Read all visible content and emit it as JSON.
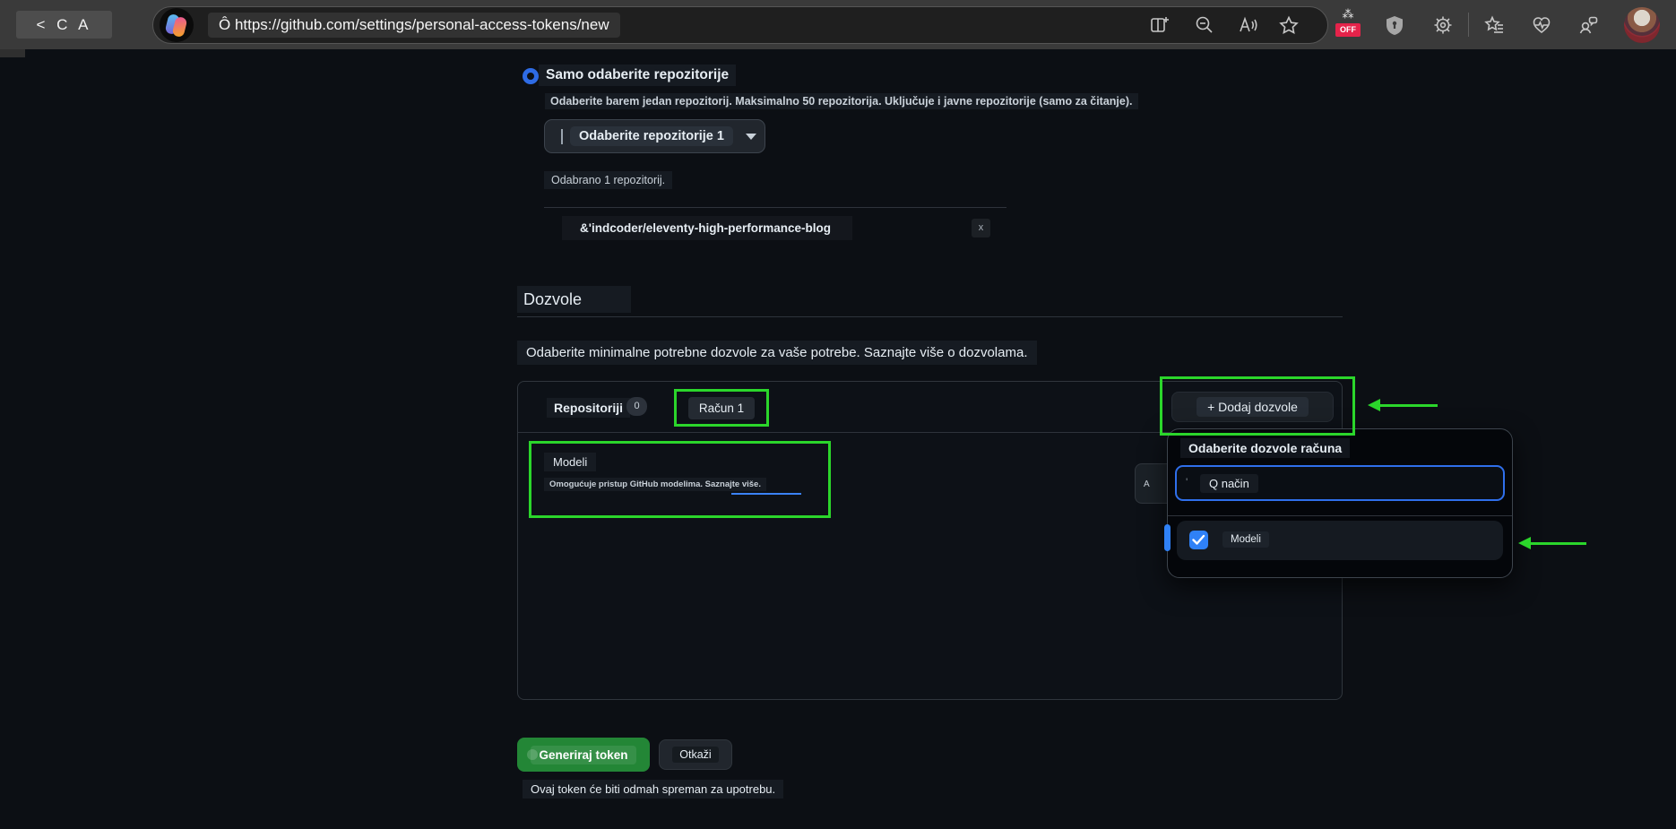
{
  "browser": {
    "nav_back_group": "< C A",
    "url": "Ô https://github.com/settings/personal-access-tokens/new",
    "off_badge": "OFF",
    "off_rays": "⁂",
    "icons": [
      "copilot-logo",
      "split-screen-icon",
      "zoom-out-icon",
      "read-aloud-icon",
      "favorite-star-icon",
      "shopping-off-icon",
      "tracking-shield-icon",
      "settings-gear-icon",
      "favorites-list-icon",
      "browser-health-icon",
      "profile-chat-icon",
      "user-avatar"
    ]
  },
  "page": {
    "repo_access": {
      "radio_label": "Samo odaberite repozitorije",
      "radio_hint": "Odaberite barem jedan repozitorij. Maksimalno 50 repozitorija. Uključuje i javne repozitorije (samo za čitanje).",
      "select_button_label": "Odaberite repozitorije 1",
      "selected_count": "Odabrano 1 repozitorij.",
      "repo_name": "&'indcoder/eleventy-high-performance-blog",
      "remove_label": "x"
    },
    "permissions": {
      "title": "Dozvole",
      "subtitle": "Odaberite minimalne potrebne dozvole za vaše potrebe. Saznajte više o dozvolama.",
      "tabs": [
        {
          "label": "Repositoriji",
          "badge": "0"
        },
        {
          "label": "Račun 1"
        }
      ],
      "add_button_label": "+ Dodaj dozvole",
      "model_section": {
        "title": "Modeli",
        "description": "Omogućuje pristup GitHub modelima. Saznajte više."
      },
      "hidden_button": "A"
    },
    "popup": {
      "title": "Odaberite dozvole računa",
      "search_value": "Q način",
      "search_tick": "'",
      "option_label": "Modeli"
    },
    "footer": {
      "generate_label": "Generiraj token",
      "cancel_label": "Otkaži",
      "note": "Ovaj token će biti odmah spreman za upotrebu."
    }
  },
  "colors": {
    "accent_blue": "#2f81f7",
    "github_green": "#238636",
    "annotation_green": "#2bd62b",
    "badge_red": "#e5234a"
  }
}
